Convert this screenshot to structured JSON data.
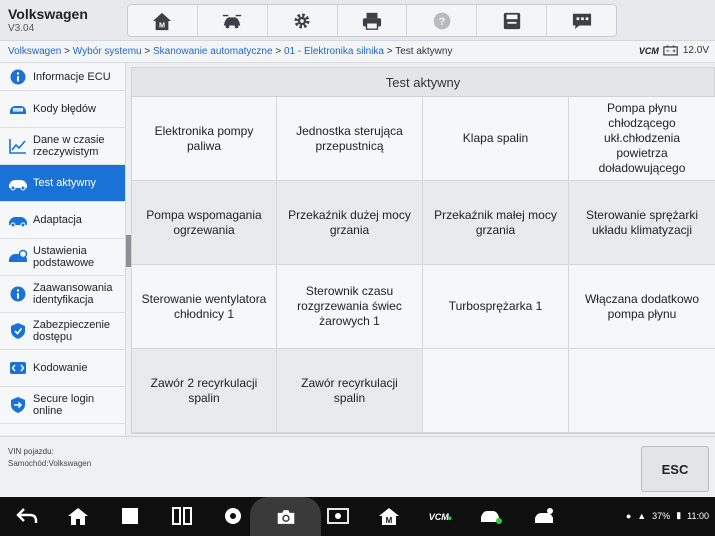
{
  "app": {
    "title": "Volkswagen",
    "version": "V3.04"
  },
  "toolbar": {
    "items": [
      {
        "icon": "home-icon"
      },
      {
        "icon": "vehicle-swap-icon"
      },
      {
        "icon": "gear-icon"
      },
      {
        "icon": "printer-icon"
      },
      {
        "icon": "help-icon"
      },
      {
        "icon": "save-icon"
      },
      {
        "icon": "message-icon"
      }
    ]
  },
  "breadcrumb": {
    "items": [
      "Volkswagen",
      "Wybór systemu",
      "Skanowanie automatyczne",
      "01 - Elektronika silnika"
    ],
    "current": "Test aktywny",
    "separator": " > "
  },
  "status": {
    "vcm": "VCM",
    "voltage": "12.0V"
  },
  "sidebar": {
    "items": [
      {
        "label": "Informacje ECU",
        "icon": "info-icon",
        "active": false
      },
      {
        "label": "Kody błędów",
        "icon": "dtc-icon",
        "active": false
      },
      {
        "label": "Dane w czasie rzeczywistym",
        "icon": "chart-line-icon",
        "active": false
      },
      {
        "label": "Test aktywny",
        "icon": "car-test-icon",
        "active": true
      },
      {
        "label": "Adaptacja",
        "icon": "car-adapt-icon",
        "active": false
      },
      {
        "label": "Ustawienia podstawowe",
        "icon": "car-settings-icon",
        "active": false
      },
      {
        "label": "Zaawansowania identyfikacja",
        "icon": "info-icon",
        "active": false
      },
      {
        "label": "Zabezpieczenie dostępu",
        "icon": "shield-icon",
        "active": false
      },
      {
        "label": "Kodowanie",
        "icon": "code-icon",
        "active": false
      },
      {
        "label": "Secure login online",
        "icon": "login-icon",
        "active": false
      }
    ]
  },
  "panel": {
    "title": "Test aktywny",
    "cells": [
      "Elektronika pompy paliwa",
      "Jednostka sterująca przepustnicą",
      "Klapa spalin",
      "Pompa płynu chłodzącego ukł.chłodzenia powietrza doładowującego",
      "Pompa wspomagania ogrzewania",
      "Przekaźnik dużej mocy grzania",
      "Przekaźnik małej mocy grzania",
      "Sterowanie sprężarki układu klimatyzacji",
      "Sterowanie wentylatora chłodnicy 1",
      "Sterownik czasu rozgrzewania świec żarowych 1",
      "Turbosprężarka 1",
      "Włączana dodatkowo pompa płynu",
      "Zawór 2 recyrkulacji spalin",
      "Zawór recyrkulacji spalin",
      "",
      ""
    ]
  },
  "info": {
    "vin_label": "VIN pojazdu:",
    "vehicle": "Samochód:Volkswagen"
  },
  "esc_label": "ESC",
  "system_tray": {
    "battery": "37%",
    "time": "11:00"
  },
  "colors": {
    "accent": "#1a72d6",
    "navbar": "#0f0f0f"
  }
}
